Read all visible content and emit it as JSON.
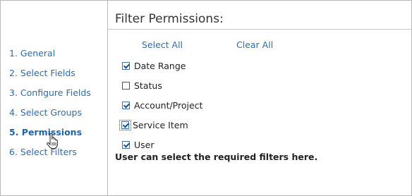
{
  "sidebar": {
    "steps": [
      {
        "label": "1. General"
      },
      {
        "label": "2. Select Fields"
      },
      {
        "label": "3. Configure Fields"
      },
      {
        "label": "4. Select Groups"
      },
      {
        "label": "5. Permissions",
        "active": true
      },
      {
        "label": "6. Select Filters"
      }
    ]
  },
  "main": {
    "title": "Filter Permissions:",
    "select_all": "Select All",
    "clear_all": "Clear All",
    "filters": [
      {
        "label": "Date Range",
        "checked": true
      },
      {
        "label": "Status",
        "checked": false
      },
      {
        "label": "Account/Project",
        "checked": true
      },
      {
        "label": "Service Item",
        "checked": true,
        "focused": true
      },
      {
        "label": "User",
        "checked": true
      }
    ],
    "help_text": "User can select the required filters here."
  },
  "colors": {
    "link": "#2a6db5",
    "border": "#b8b8b8"
  }
}
